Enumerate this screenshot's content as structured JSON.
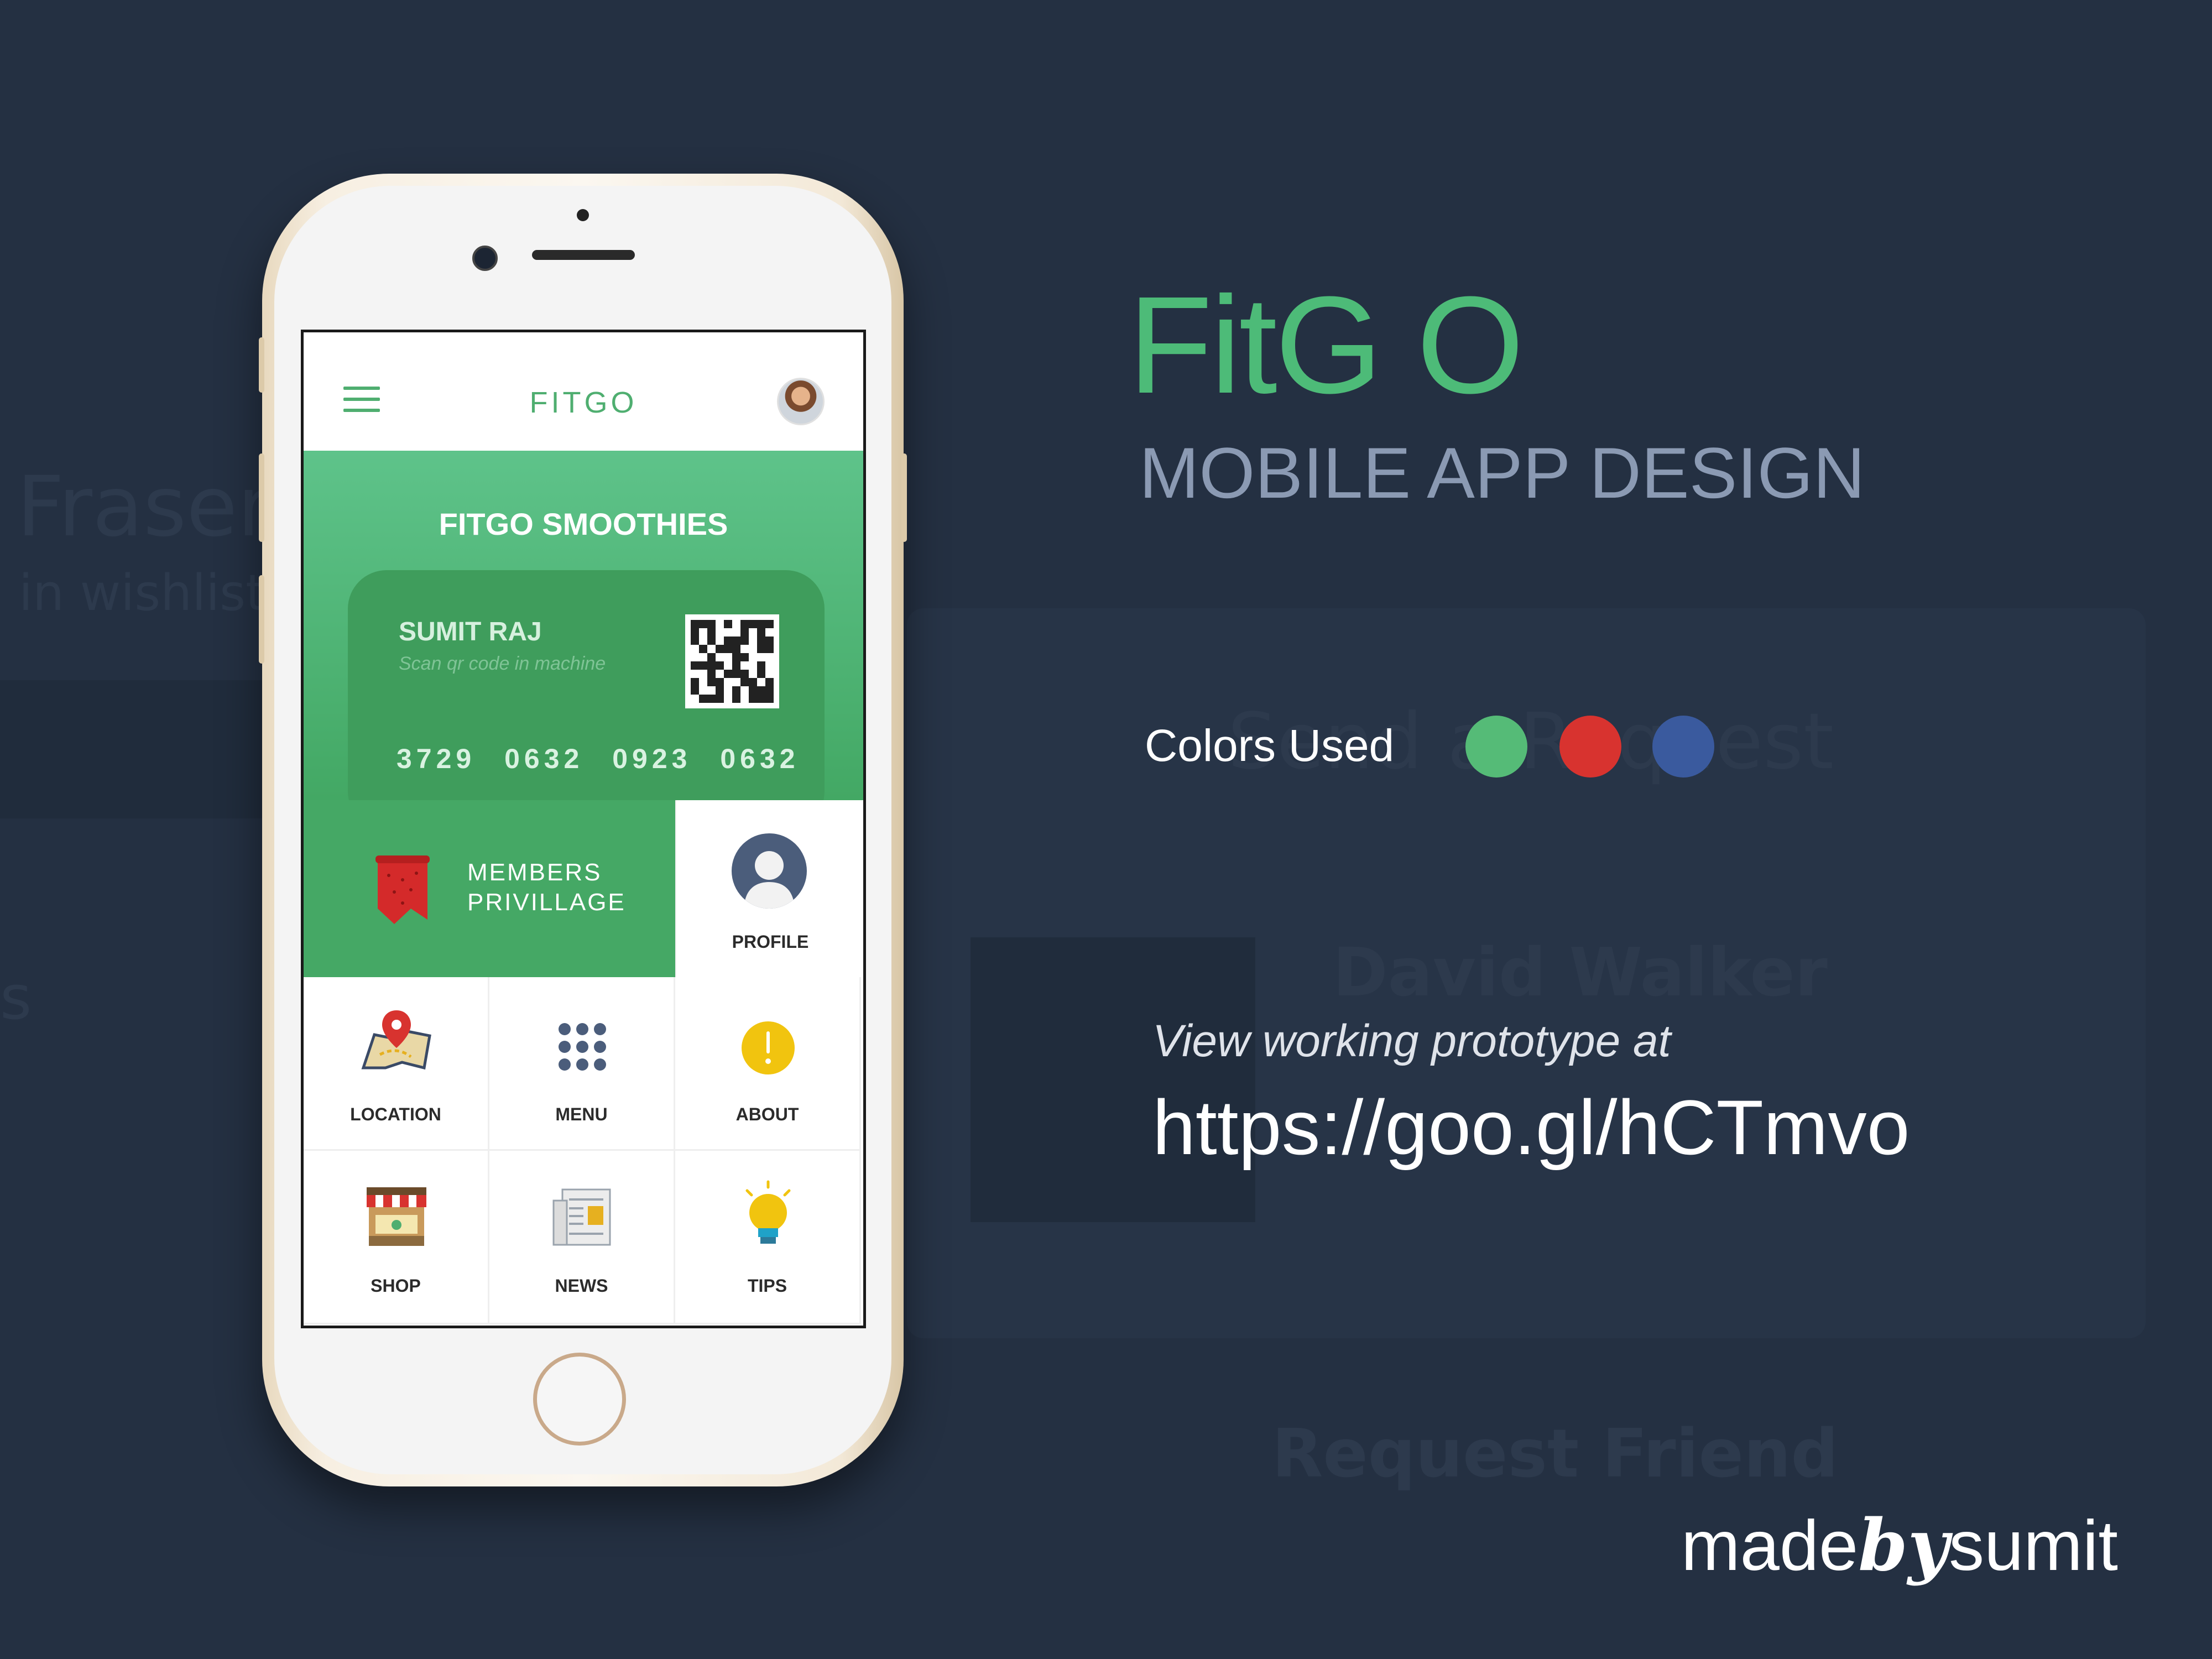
{
  "background_ghost": {
    "name_fragment": "Fraser",
    "wishlist_fragment": "in wishlist",
    "send_request": "Send a Request",
    "person_name": "David Walker",
    "request_friend": "Request Friend",
    "side_fragment": "s"
  },
  "phone": {
    "app_bar": {
      "brand": "FITGO",
      "menu_icon": "hamburger-menu-icon",
      "avatar": "user-avatar"
    },
    "hero": {
      "title": "FITGO SMOOTHIES",
      "card": {
        "name": "SUMIT RAJ",
        "hint": "Scan qr code in machine",
        "number": "3729 0632 0923 0632"
      }
    },
    "members_tile": {
      "line1": "MEMBERS",
      "line2": "PRIVILLAGE",
      "icon": "ribbon-bookmark-icon"
    },
    "profile_tile": {
      "label": "PROFILE",
      "icon": "user-silhouette-icon"
    },
    "tiles": [
      {
        "label": "LOCATION",
        "icon": "map-pin-icon"
      },
      {
        "label": "MENU",
        "icon": "dots-grid-icon"
      },
      {
        "label": "ABOUT",
        "icon": "info-exclamation-icon"
      },
      {
        "label": "SHOP",
        "icon": "storefront-icon"
      },
      {
        "label": "NEWS",
        "icon": "newspaper-icon"
      },
      {
        "label": "TIPS",
        "icon": "lightbulb-icon"
      }
    ]
  },
  "showcase": {
    "title": "FitG O",
    "subtitle": "MOBILE APP DESIGN",
    "colors_label": "Colors Used",
    "colors": [
      "#55bb77",
      "#d8332f",
      "#3a5a9e"
    ],
    "prototype_label": "View working prototype at",
    "prototype_url": "https://goo.gl/hCTmvo",
    "credit_pre": "made",
    "credit_by": "by",
    "credit_post": "sumit"
  }
}
